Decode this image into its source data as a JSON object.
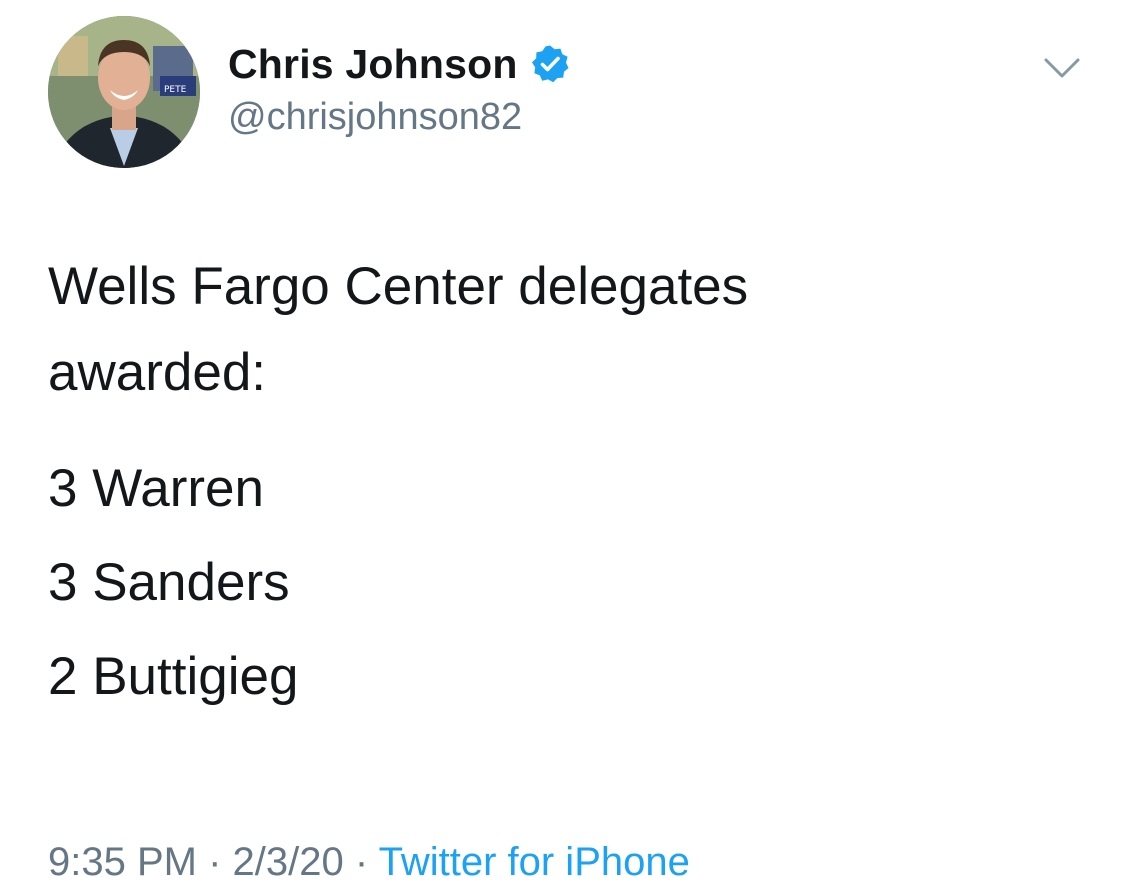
{
  "author": {
    "display_name": "Chris Johnson",
    "handle": "@chrisjohnson82",
    "verified": true,
    "avatar_sign_text": "PETE"
  },
  "tweet": {
    "text_line1": "Wells Fargo Center delegates",
    "text_line2": "awarded:",
    "results": [
      {
        "text": "3 Warren"
      },
      {
        "text": "3 Sanders"
      },
      {
        "text": "2 Buttigieg"
      }
    ]
  },
  "meta": {
    "time": "9:35 PM",
    "date": "2/3/20",
    "separator": "·",
    "source": "Twitter for iPhone"
  },
  "colors": {
    "verified_badge": "#1da1f2",
    "secondary_text": "#657786",
    "link": "#1da1f2",
    "primary_text": "#14171a"
  },
  "icons": {
    "menu": "chevron-down-icon",
    "verified": "verified-badge-icon"
  }
}
